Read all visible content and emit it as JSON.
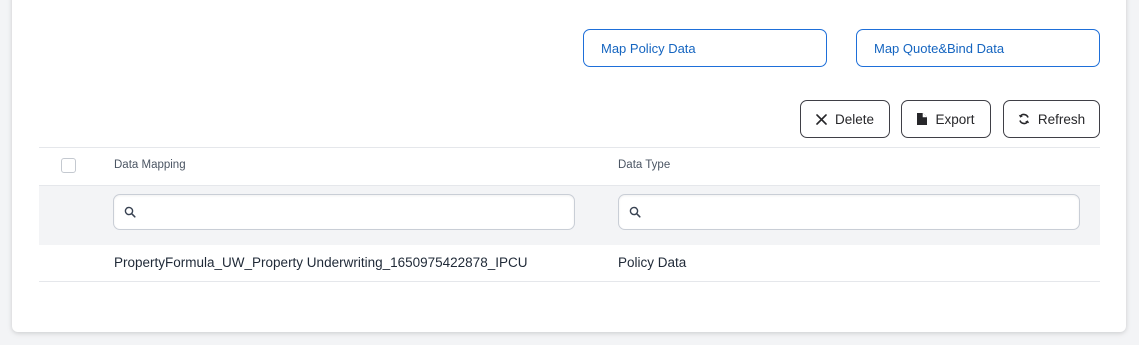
{
  "actions": {
    "map_policy_label": "Map Policy Data",
    "map_quote_bind_label": "Map Quote&Bind Data"
  },
  "toolbar": {
    "delete_label": "Delete",
    "export_label": "Export",
    "refresh_label": "Refresh"
  },
  "table": {
    "columns": [
      "Data Mapping",
      "Data Type"
    ],
    "filters": [
      {
        "placeholder": "",
        "icon": "search-icon"
      },
      {
        "placeholder": "",
        "icon": "search-icon"
      }
    ],
    "rows": [
      [
        "PropertyFormula_UW_Property Underwriting_1650975422878_IPCU",
        "Policy Data"
      ]
    ]
  },
  "colors": {
    "accent": "#1565c0",
    "border": "#3f3f46",
    "filter_row_bg": "#f3f4f6"
  }
}
